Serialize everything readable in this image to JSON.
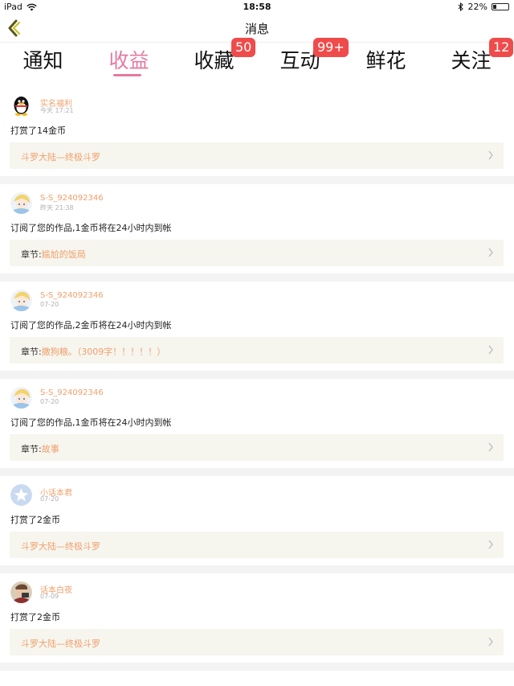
{
  "status_bar": {
    "device": "iPad",
    "time": "18:58",
    "battery": "22%"
  },
  "nav": {
    "title": "消息"
  },
  "tabs": [
    {
      "label": "通知",
      "badge": ""
    },
    {
      "label": "收益",
      "badge": ""
    },
    {
      "label": "收藏",
      "badge": "50"
    },
    {
      "label": "互动",
      "badge": "99+"
    },
    {
      "label": "鲜花",
      "badge": ""
    },
    {
      "label": "关注",
      "badge": "12"
    }
  ],
  "active_tab": "收益",
  "colors": {
    "accent": "#e479a2",
    "name": "#f0a06c",
    "badge": "#f04b4b",
    "link_bg": "#f6f5ee"
  },
  "feed": [
    {
      "name": "实名福利",
      "time": "今天 17:21",
      "text": "打赏了14金币",
      "link_prefix": "",
      "link": "斗罗大陆—终极斗罗",
      "avatar": "penguin-avatar"
    },
    {
      "name": "S-S_924092346",
      "time": "昨天 21:38",
      "text": "订阅了您的作品,1金币将在24小时内到帐",
      "link_prefix": "章节:",
      "link": "尴尬的饭局",
      "avatar": "anime-avatar"
    },
    {
      "name": "S-S_924092346",
      "time": "07-20",
      "text": "订阅了您的作品,2金币将在24小时内到帐",
      "link_prefix": "章节:",
      "link": "撒狗粮。（3009字！！！！！）",
      "avatar": "anime-avatar"
    },
    {
      "name": "S-S_924092346",
      "time": "07-20",
      "text": "订阅了您的作品,1金币将在24小时内到帐",
      "link_prefix": "章节:",
      "link": "故事",
      "avatar": "anime-avatar"
    },
    {
      "name": "小话本君",
      "time": "07-20",
      "text": "打赏了2金币",
      "link_prefix": "",
      "link": "斗罗大陆—终极斗罗",
      "avatar": "star-avatar"
    },
    {
      "name": "话本白夜",
      "time": "07-09",
      "text": "打赏了2金币",
      "link_prefix": "",
      "link": "斗罗大陆—终极斗罗",
      "avatar": "photo-avatar"
    }
  ]
}
